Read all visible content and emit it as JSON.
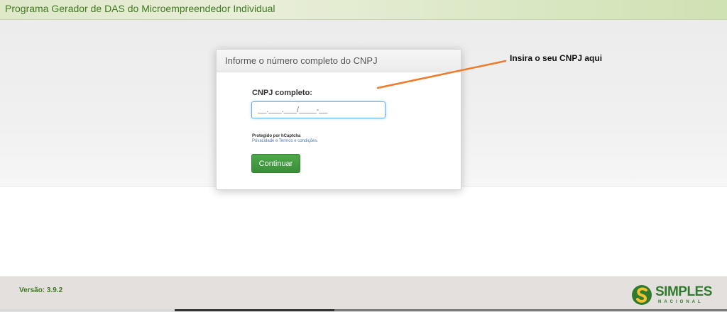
{
  "header": {
    "app_title": "Programa Gerador de DAS do Microempreendedor Individual"
  },
  "form": {
    "title": "Informe o número completo do CNPJ",
    "cnpj_label": "CNPJ completo:",
    "cnpj_placeholder": "__.___.___/____-__",
    "captcha_title": "Protegido por hCaptcha",
    "captcha_links": "Privacidade e Termos e condições.",
    "continue_label": "Continuar"
  },
  "annotation": {
    "text": "Insira o seu CNPJ aqui",
    "color": "#f07a2a"
  },
  "footer": {
    "version": "Versão: 3.9.2",
    "logo_word": "SIMPLES",
    "logo_sub": "NACIONAL"
  },
  "colors": {
    "accent_green": "#3f7a1f",
    "button_green": "#3b8f39",
    "focus_blue": "#66afe9"
  }
}
